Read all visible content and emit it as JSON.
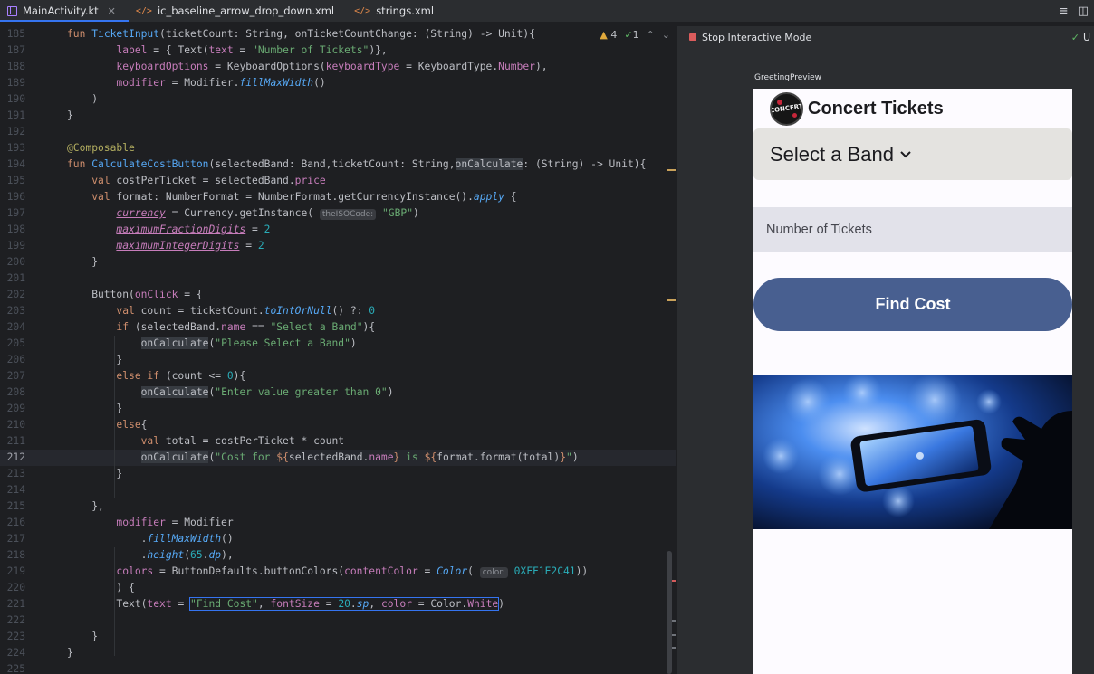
{
  "tabs": [
    {
      "label": "MainActivity.kt",
      "icon": "kotlin-file-icon",
      "active": true
    },
    {
      "label": "ic_baseline_arrow_drop_down.xml",
      "icon": "xml-file-icon",
      "active": false
    },
    {
      "label": "strings.xml",
      "icon": "xml-file-icon",
      "active": false
    }
  ],
  "editor": {
    "warnings": "4",
    "checks": "1",
    "current_line": "212"
  },
  "preview": {
    "stop_label": "Stop Interactive Mode",
    "right_label": "U",
    "preview_name": "GreetingPreview",
    "app": {
      "title": "Concert Tickets",
      "logo_text": "CONCERT",
      "band_label": "Select a Band",
      "tickets_placeholder": "Number of Tickets",
      "button_label": "Find Cost"
    }
  },
  "colors": {
    "accent": "#3574f0",
    "button": "#485f90",
    "band_select_bg": "#e4e3e0",
    "field_bg": "#e2e2ea"
  }
}
